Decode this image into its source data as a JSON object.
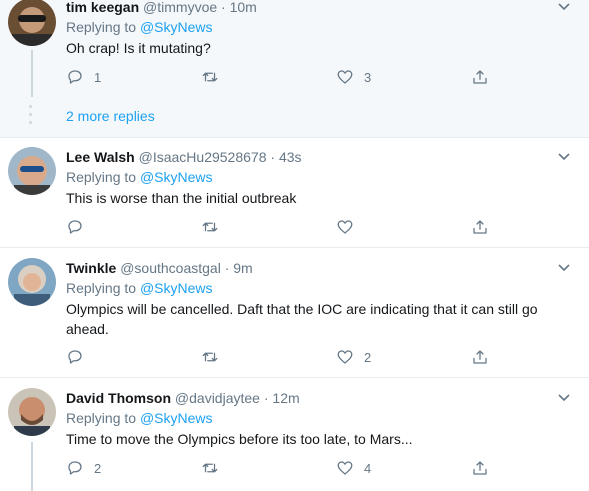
{
  "tweets": [
    {
      "name": "tim keegan",
      "handle": "@timmyvoe",
      "separator": "·",
      "time": "10m",
      "replying_prefix": "Replying to ",
      "replying_to": "@SkyNews",
      "text": "Oh crap! Is it mutating?",
      "reply_count": "1",
      "retweet_count": "",
      "like_count": "3"
    },
    {
      "name": "Lee Walsh",
      "handle": "@IsaacHu29528678",
      "separator": "·",
      "time": "43s",
      "replying_prefix": "Replying to ",
      "replying_to": "@SkyNews",
      "text": "This is worse than the initial outbreak",
      "reply_count": "",
      "retweet_count": "",
      "like_count": ""
    },
    {
      "name": "Twinkle",
      "handle": "@southcoastgal",
      "separator": "·",
      "time": "9m",
      "replying_prefix": "Replying to ",
      "replying_to": "@SkyNews",
      "text": "Olympics will be cancelled. Daft that the IOC are indicating that it can still go ahead.",
      "reply_count": "",
      "retweet_count": "",
      "like_count": "2"
    },
    {
      "name": "David Thomson",
      "handle": "@davidjaytee",
      "separator": "·",
      "time": "12m",
      "replying_prefix": "Replying to ",
      "replying_to": "@SkyNews",
      "text": "Time to move the Olympics before its too late, to Mars...",
      "reply_count": "2",
      "retweet_count": "",
      "like_count": "4"
    }
  ],
  "more_replies_label": "2 more replies",
  "colors": {
    "accent": "#1da1f2",
    "secondary_text": "#657786",
    "thread_bg": "#f5f8fa",
    "divider": "#e6ecf0"
  },
  "icons": {
    "reply": "reply-icon",
    "retweet": "retweet-icon",
    "like": "heart-icon",
    "share": "share-icon",
    "caret": "chevron-down-icon"
  }
}
